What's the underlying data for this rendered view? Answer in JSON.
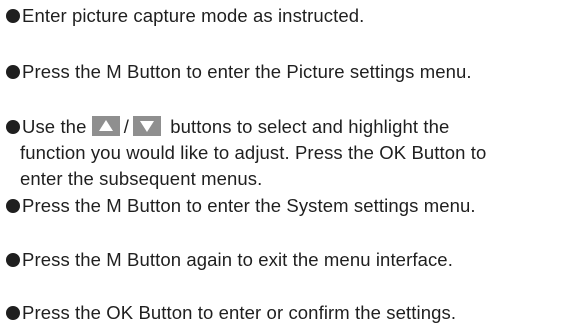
{
  "instructions": [
    {
      "text": "Enter picture capture mode as instructed."
    },
    {
      "text": "Press the M Button to enter the Picture settings menu."
    },
    {
      "prefix": "Use the",
      "separator": "/",
      "suffix": "buttons to select and highlight the",
      "line2": "function you would like to adjust. Press the OK Button to",
      "line3": "enter the subsequent menus.",
      "icons": [
        "up-arrow-button-icon",
        "down-arrow-button-icon"
      ]
    },
    {
      "text": "Press the M Button to enter the System settings menu."
    },
    {
      "text": "Press the M Button again to exit the menu interface."
    },
    {
      "text": "Press the OK Button to enter or confirm the settings."
    }
  ],
  "colors": {
    "text": "#1f1f1f",
    "button_fill": "#8f8f8f",
    "arrow": "#ffffff"
  }
}
